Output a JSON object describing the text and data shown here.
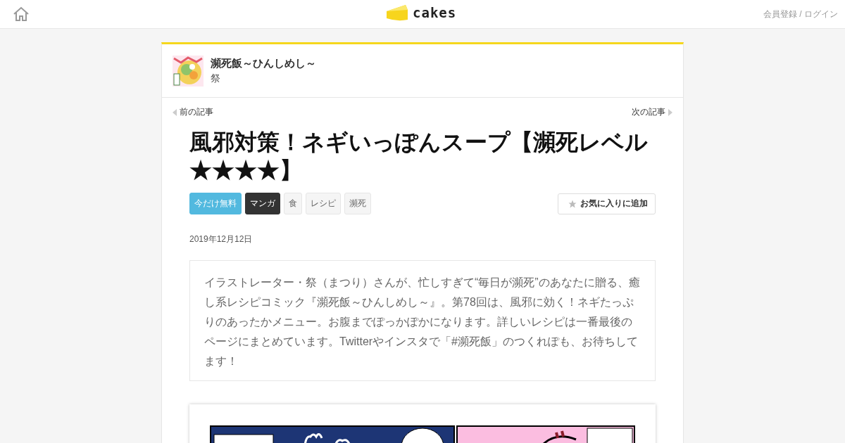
{
  "header": {
    "logo_text": "cakes",
    "account_link": "会員登録 / ログイン"
  },
  "series": {
    "title": "瀕死飯～ひんしめし～",
    "author": "祭"
  },
  "nav": {
    "prev": "前の記事",
    "next": "次の記事"
  },
  "article": {
    "title": "風邪対策！ネギいっぽんスープ【瀕死レベル★★★★】",
    "tags": [
      {
        "label": "今だけ無料",
        "kind": "free"
      },
      {
        "label": "マンガ",
        "kind": "category"
      },
      {
        "label": "食",
        "kind": "tag"
      },
      {
        "label": "レシピ",
        "kind": "tag"
      },
      {
        "label": "瀕死",
        "kind": "tag"
      }
    ],
    "favorite_button": "お気に入りに追加",
    "date": "2019年12月12日",
    "summary": "イラストレーター・祭（まつり）さんが、忙しすぎて“毎日が瀕死”のあなたに贈る、癒し系レシピコミック『瀕死飯～ひんしめし～』。第78回は、風邪に効く！ネギたっぷりのあったかメニュー。お腹までぽっかぽかになります。詳しいレシピは一番最後のページにまとめています。Twitterやインスタで「#瀕死飯」のつくれぽも、お待ちしてます！"
  }
}
